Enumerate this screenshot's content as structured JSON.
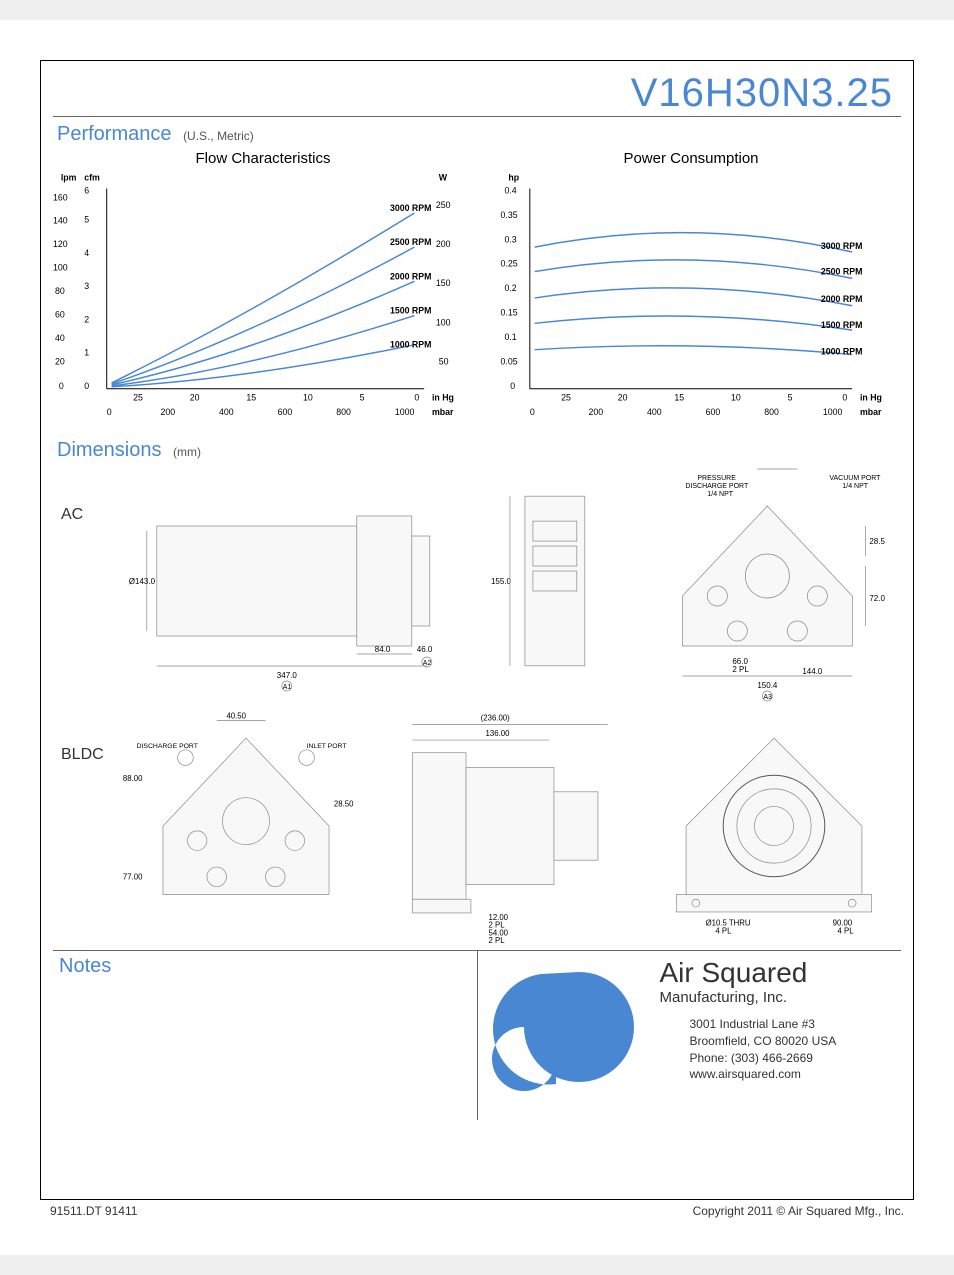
{
  "model_title": "V16H30N3.25",
  "performance": {
    "heading": "Performance",
    "units_note": "(U.S., Metric)",
    "flow_title": "Flow Characteristics",
    "power_title": "Power Consumption",
    "axis": {
      "flow_left_outer": "lpm",
      "flow_left_inner": "cfm",
      "power_left_outer": "W",
      "power_left_inner": "hp",
      "x_right": "in Hg",
      "x_right_bottom": "mbar"
    }
  },
  "chart_data": [
    {
      "type": "line",
      "title": "Flow Characteristics",
      "x_in_hg": [
        25,
        20,
        15,
        10,
        5,
        0
      ],
      "x_mbar": [
        0,
        200,
        400,
        600,
        800,
        1000
      ],
      "y_left_lpm_ticks": [
        0,
        20,
        40,
        60,
        80,
        100,
        120,
        140,
        160
      ],
      "y_right_W_ticks": [
        50,
        100,
        150,
        200,
        250
      ],
      "y_cfm_ticks": [
        0,
        1,
        2,
        3,
        4,
        5,
        6
      ],
      "series": [
        {
          "name": "1000 RPM",
          "values_cfm": [
            0,
            0.2,
            0.4,
            0.7,
            1.0,
            1.3
          ]
        },
        {
          "name": "1500 RPM",
          "values_cfm": [
            0,
            0.3,
            0.7,
            1.2,
            1.7,
            2.2
          ]
        },
        {
          "name": "2000 RPM",
          "values_cfm": [
            0,
            0.5,
            1.1,
            1.8,
            2.5,
            3.2
          ]
        },
        {
          "name": "2500 RPM",
          "values_cfm": [
            0,
            0.7,
            1.5,
            2.4,
            3.3,
            4.3
          ]
        },
        {
          "name": "3000 RPM",
          "values_cfm": [
            0,
            0.9,
            1.9,
            3.0,
            4.2,
            5.4
          ]
        }
      ]
    },
    {
      "type": "line",
      "title": "Power Consumption",
      "x_in_hg": [
        25,
        20,
        15,
        10,
        5,
        0
      ],
      "x_mbar": [
        0,
        200,
        400,
        600,
        800,
        1000
      ],
      "y_hp_ticks": [
        0,
        0.05,
        0.1,
        0.15,
        0.2,
        0.25,
        0.3,
        0.35,
        0.4
      ],
      "series": [
        {
          "name": "1000 RPM",
          "values_hp": [
            0.08,
            0.085,
            0.09,
            0.09,
            0.085,
            0.075
          ]
        },
        {
          "name": "1500 RPM",
          "values_hp": [
            0.14,
            0.155,
            0.165,
            0.165,
            0.155,
            0.13
          ]
        },
        {
          "name": "2000 RPM",
          "values_hp": [
            0.19,
            0.21,
            0.225,
            0.225,
            0.21,
            0.18
          ]
        },
        {
          "name": "2500 RPM",
          "values_hp": [
            0.25,
            0.275,
            0.29,
            0.29,
            0.275,
            0.24
          ]
        },
        {
          "name": "3000 RPM",
          "values_hp": [
            0.31,
            0.34,
            0.355,
            0.355,
            0.34,
            0.3
          ]
        }
      ]
    }
  ],
  "dimensions": {
    "heading": "Dimensions",
    "units_note": "(mm)",
    "variant_ac": "AC",
    "variant_bldc": "BLDC",
    "labels": {
      "pressure_discharge": "PRESSURE\nDISCHARGE PORT\n1/4 NPT",
      "vacuum_port": "VACUUM PORT\n1/4 NPT",
      "discharge_port": "DISCHARGE PORT",
      "inlet_port": "INLET PORT",
      "d143": "Ø143.0",
      "d347": "347.0",
      "a1": "A1",
      "d84": "84.0",
      "d46": "46.0",
      "a2": "A2",
      "d155": "155.0",
      "d405": "40.5",
      "d285": "28.5",
      "d72": "72.0",
      "d66": "66.0",
      "d2pl": "2 PL",
      "d144": "144.0",
      "d1504": "150.4",
      "a3": "A3",
      "d4050b": "40.50",
      "d88": "88.00",
      "d2850b": "28.50",
      "d77": "77.00",
      "d236": "(236.00)",
      "d136": "136.00",
      "d12": "12.00",
      "d54": "54.00",
      "d105thru": "Ø10.5 THRU",
      "d4pl": "4 PL",
      "d90": "90.00"
    }
  },
  "notes": {
    "heading": "Notes"
  },
  "company": {
    "name": "Air Squared",
    "sub": "Manufacturing, Inc.",
    "addr1": "3001 Industrial Lane #3",
    "addr2": "Broomfield, CO 80020 USA",
    "phone": "Phone: (303) 466-2669",
    "web": "www.airsquared.com"
  },
  "footer": {
    "left": "91511.DT 91411",
    "right": "Copyright 2011 © Air Squared Mfg., Inc."
  }
}
